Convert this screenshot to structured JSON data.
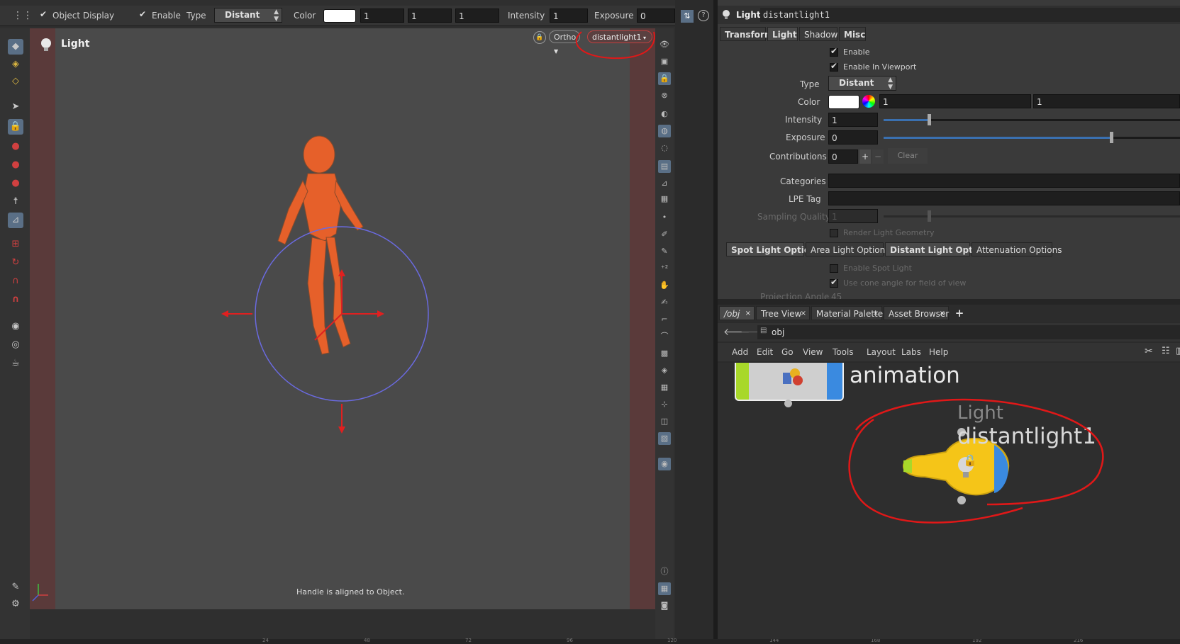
{
  "toolbar": {
    "object_display": "Object Display",
    "enable": "Enable",
    "type_label": "Type",
    "type_value": "Distant",
    "color_label": "Color",
    "color_r": "1",
    "color_g": "1",
    "color_b": "1",
    "intensity_label": "Intensity",
    "intensity_value": "1",
    "exposure_label": "Exposure",
    "exposure_value": "0",
    "help": "?"
  },
  "viewport": {
    "title": "Light",
    "camera_menu": "Ortho",
    "light_menu": "distantlight1",
    "status": "Handle is aligned to Object.",
    "timeline_ticks": [
      "24",
      "48",
      "72",
      "96",
      "120",
      "144",
      "168",
      "192",
      "216"
    ]
  },
  "params": {
    "node_type": "Light",
    "node_name": "distantlight1",
    "tabs": [
      "Transform",
      "Light",
      "Shadow",
      "Misc"
    ],
    "enable": "Enable",
    "enable_viewport": "Enable In Viewport",
    "type_label": "Type",
    "type_value": "Distant",
    "color_label": "Color",
    "color_r": "1",
    "color_g": "1",
    "intensity_label": "Intensity",
    "intensity_value": "1",
    "exposure_label": "Exposure",
    "exposure_value": "0",
    "contributions_label": "Contributions",
    "contributions_value": "0",
    "plus": "+",
    "minus": "−",
    "clear": "Clear",
    "categories_label": "Categories",
    "lpe_label": "LPE Tag",
    "sampling_label": "Sampling Quality",
    "sampling_value": "1",
    "render_geo": "Render Light Geometry",
    "sub_tabs": [
      "Spot Light Options",
      "Area Light Options",
      "Distant Light Options",
      "Attenuation Options"
    ],
    "enable_spot": "Enable Spot Light",
    "use_cone": "Use cone angle for field of view",
    "projection_label": "Projection Angle",
    "projection_value": "45"
  },
  "network": {
    "pane_tabs": [
      "/obj",
      "Tree View",
      "Material Palette",
      "Asset Browser"
    ],
    "add_tab": "+",
    "path": "obj",
    "menu": [
      "Add",
      "Edit",
      "Go",
      "View",
      "Tools",
      "Layout",
      "Labs",
      "Help"
    ],
    "node1_name": "animation",
    "node2_type": "Light",
    "node2_name": "distantlight1"
  },
  "colors": {
    "annotation": "#e01818",
    "selection": "#5a6f86",
    "light_node": "#f5c518",
    "viewport_bg": "#4a4a4a"
  }
}
